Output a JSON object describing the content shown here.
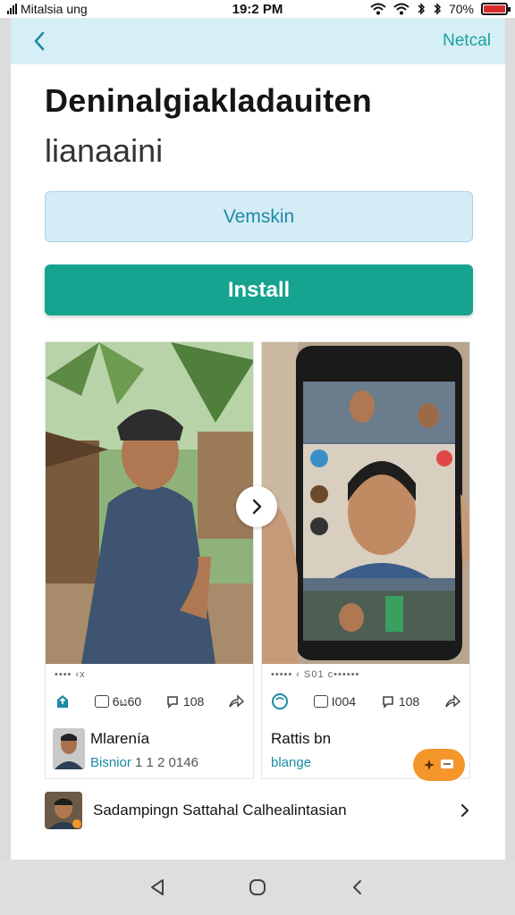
{
  "status_bar": {
    "carrier": "Mitalsia ung",
    "time": "19:2 PM",
    "battery_text": "70%",
    "icons": [
      "signal-icon",
      "wifi-icon",
      "bluetooth-icon",
      "battery-icon"
    ]
  },
  "app_bar": {
    "back_icon": "chevron-left-icon",
    "next_label": "Netcal"
  },
  "header": {
    "title": "Deninalgiakladauiten",
    "subtitle": "lianaaini"
  },
  "buttons": {
    "secondary_label": "Vemskin",
    "primary_label": "Install"
  },
  "cards": [
    {
      "meta": "•••• ‹x",
      "actions": [
        {
          "icon": "share-icon",
          "label": ""
        },
        {
          "icon": "comment-icon",
          "label": "6ಟ60"
        },
        {
          "icon": "reply-icon",
          "label": "108"
        },
        {
          "icon": "forward-icon",
          "label": ""
        }
      ],
      "author_name": "Mlarenía",
      "author_handle": "Bisnior",
      "author_numbers": "1 1 2 0146"
    },
    {
      "meta": "••••• ‹ S01 c••••••",
      "actions": [
        {
          "icon": "like-icon",
          "label": ""
        },
        {
          "icon": "comment-icon",
          "label": "I004"
        },
        {
          "icon": "reply-icon",
          "label": "108"
        },
        {
          "icon": "forward-icon",
          "label": ""
        }
      ],
      "author_name": "Rattis bn",
      "author_handle": "blange"
    }
  ],
  "list_item": {
    "label": "Sadampingn Sattahal Calhealintasian",
    "chevron": "chevron-right-icon"
  },
  "colors": {
    "accent": "#16a390",
    "appbar": "#d6eef5",
    "link": "#1d8aa6",
    "fab": "#f5962b"
  }
}
